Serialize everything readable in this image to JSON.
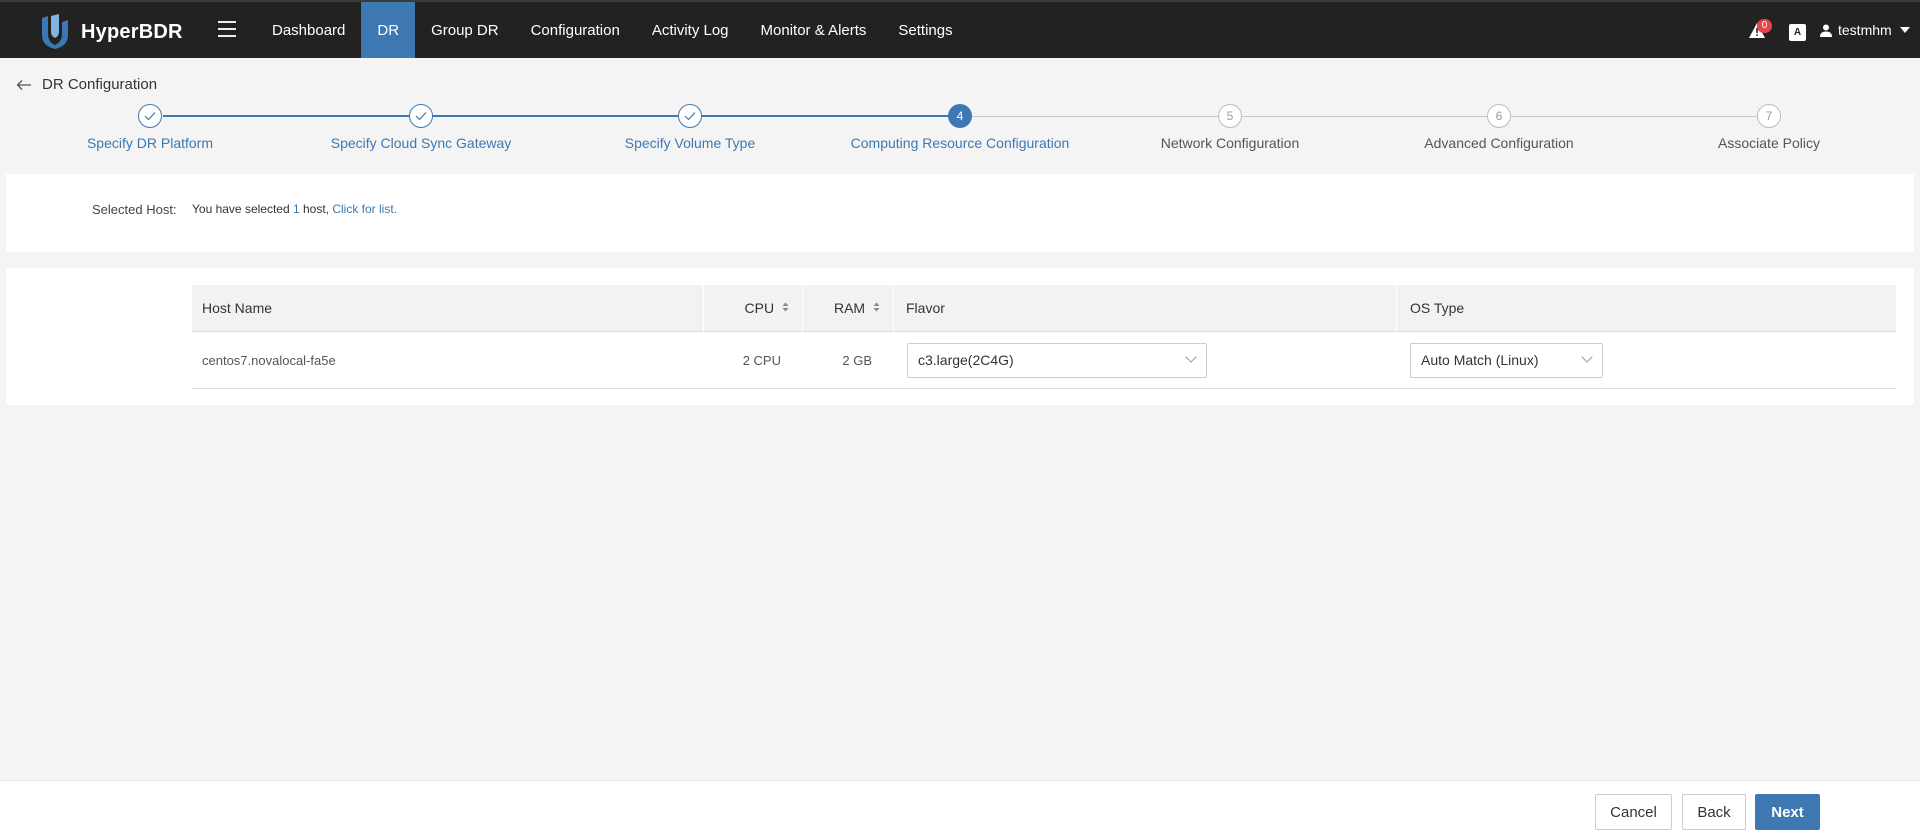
{
  "app": {
    "name": "HyperBDR"
  },
  "nav": {
    "items": [
      {
        "label": "Dashboard",
        "active": false
      },
      {
        "label": "DR",
        "active": true
      },
      {
        "label": "Group DR",
        "active": false
      },
      {
        "label": "Configuration",
        "active": false
      },
      {
        "label": "Activity Log",
        "active": false
      },
      {
        "label": "Monitor & Alerts",
        "active": false
      },
      {
        "label": "Settings",
        "active": false
      }
    ]
  },
  "header": {
    "alert_count": "0",
    "lang_icon": "A",
    "username": "testmhm"
  },
  "page": {
    "title": "DR Configuration"
  },
  "stepper": {
    "steps": [
      {
        "number": "1",
        "label": "Specify DR Platform",
        "status": "done"
      },
      {
        "number": "2",
        "label": "Specify Cloud Sync Gateway",
        "status": "done"
      },
      {
        "number": "3",
        "label": "Specify Volume Type",
        "status": "done"
      },
      {
        "number": "4",
        "label": "Computing Resource Configuration",
        "status": "current"
      },
      {
        "number": "5",
        "label": "Network Configuration",
        "status": "pending"
      },
      {
        "number": "6",
        "label": "Advanced Configuration",
        "status": "pending"
      },
      {
        "number": "7",
        "label": "Associate Policy",
        "status": "pending"
      }
    ]
  },
  "selected_host": {
    "label": "Selected Host:",
    "text_prefix": "You have selected ",
    "count": "1",
    "text_suffix": " host, ",
    "link": "Click for list."
  },
  "table": {
    "headers": {
      "host_name": "Host Name",
      "cpu": "CPU",
      "ram": "RAM",
      "flavor": "Flavor",
      "os_type": "OS Type"
    },
    "rows": [
      {
        "host_name": "centos7.novalocal-fa5e",
        "cpu": "2 CPU",
        "ram": "2 GB",
        "flavor": "c3.large(2C4G)",
        "os_type": "Auto Match (Linux)"
      }
    ]
  },
  "footer": {
    "cancel": "Cancel",
    "back": "Back",
    "next": "Next"
  },
  "colors": {
    "accent": "#3d78b3",
    "topbar": "#222222",
    "badge": "#e8424a"
  }
}
